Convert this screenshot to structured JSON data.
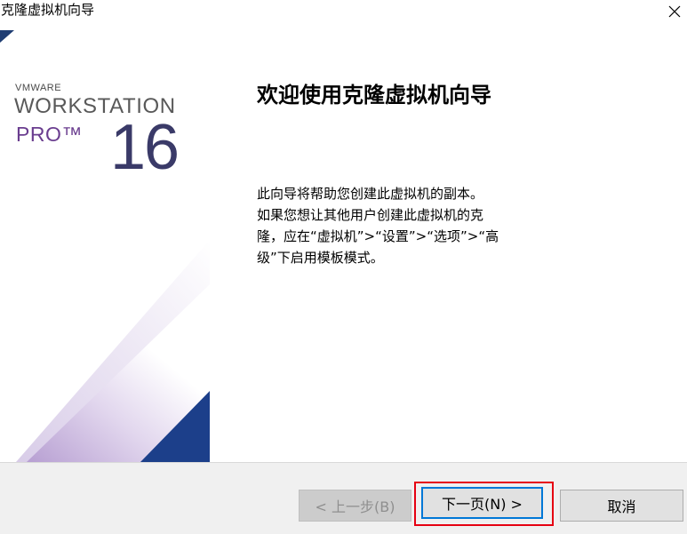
{
  "window": {
    "title": "克隆虚拟机向导",
    "close_icon": "×"
  },
  "branding": {
    "vmware": "VMWARE",
    "workstation": "WORKSTATION",
    "pro": "PRO™",
    "version": "16",
    "colors": {
      "purple": "#6a3d8f",
      "navy": "#1c3f8a",
      "corner": "#1f3d73"
    }
  },
  "content": {
    "heading": "欢迎使用克隆虚拟机向导",
    "description_lines": [
      "此向导将帮助您创建此虚拟机的副本。",
      "如果您想让其他用户创建此虚拟机的克",
      "隆，应在“虚拟机”>“设置”>“选项”>“高",
      "级”下启用模板模式。"
    ]
  },
  "buttons": {
    "back": "< 上一步(B)",
    "next": "下一页(N) >",
    "cancel": "取消"
  }
}
